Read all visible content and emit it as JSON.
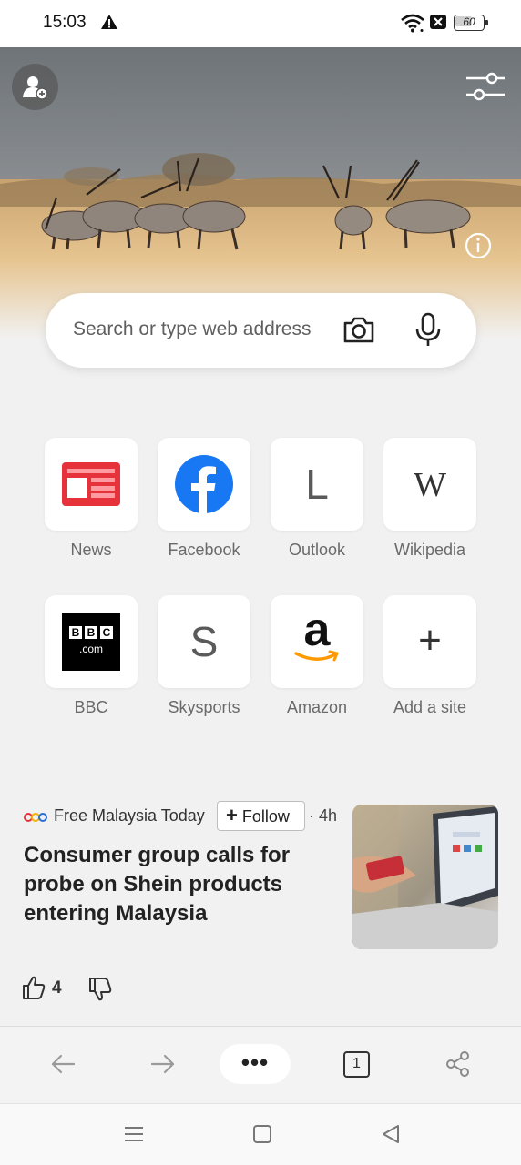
{
  "status_bar": {
    "time": "15:03",
    "battery_level": "60",
    "icons": [
      "warning-icon",
      "wifi-icon",
      "sim-off-icon",
      "battery-icon"
    ]
  },
  "hero": {
    "icons": [
      "add-profile-icon",
      "settings-sliders-icon",
      "info-icon"
    ]
  },
  "search": {
    "placeholder": "Search or type web address",
    "icons": [
      "camera-icon",
      "microphone-icon"
    ]
  },
  "top_sites": [
    {
      "label": "News",
      "icon": "news-icon"
    },
    {
      "label": "Facebook",
      "icon": "facebook-icon"
    },
    {
      "label": "Outlook",
      "icon": "letter-icon",
      "letter": "L"
    },
    {
      "label": "Wikipedia",
      "icon": "wikipedia-icon",
      "letter": "W"
    },
    {
      "label": "BBC",
      "icon": "bbc-icon",
      "logo_text": [
        "B",
        "B",
        "C"
      ],
      "logo_sub": ".com"
    },
    {
      "label": "Skysports",
      "icon": "letter-icon",
      "letter": "S"
    },
    {
      "label": "Amazon",
      "icon": "amazon-icon",
      "letter": "a"
    },
    {
      "label": "Add a site",
      "icon": "plus-icon",
      "letter": "+"
    }
  ],
  "news": {
    "source": "Free Malaysia Today",
    "follow_label": "Follow",
    "follow_icon": "+",
    "time": "· 4h",
    "headline": "Consumer group calls for probe on Shein products entering Malaysia",
    "likes": "4"
  },
  "toolbar": {
    "menu_label": "•••",
    "tab_count": "1",
    "icons": [
      "back-arrow-icon",
      "forward-arrow-icon",
      "share-icon"
    ]
  },
  "colors": {
    "facebook": "#1877f2",
    "news_red": "#e5323b",
    "amazon_orange": "#f90",
    "background": "#f1f1f1"
  }
}
